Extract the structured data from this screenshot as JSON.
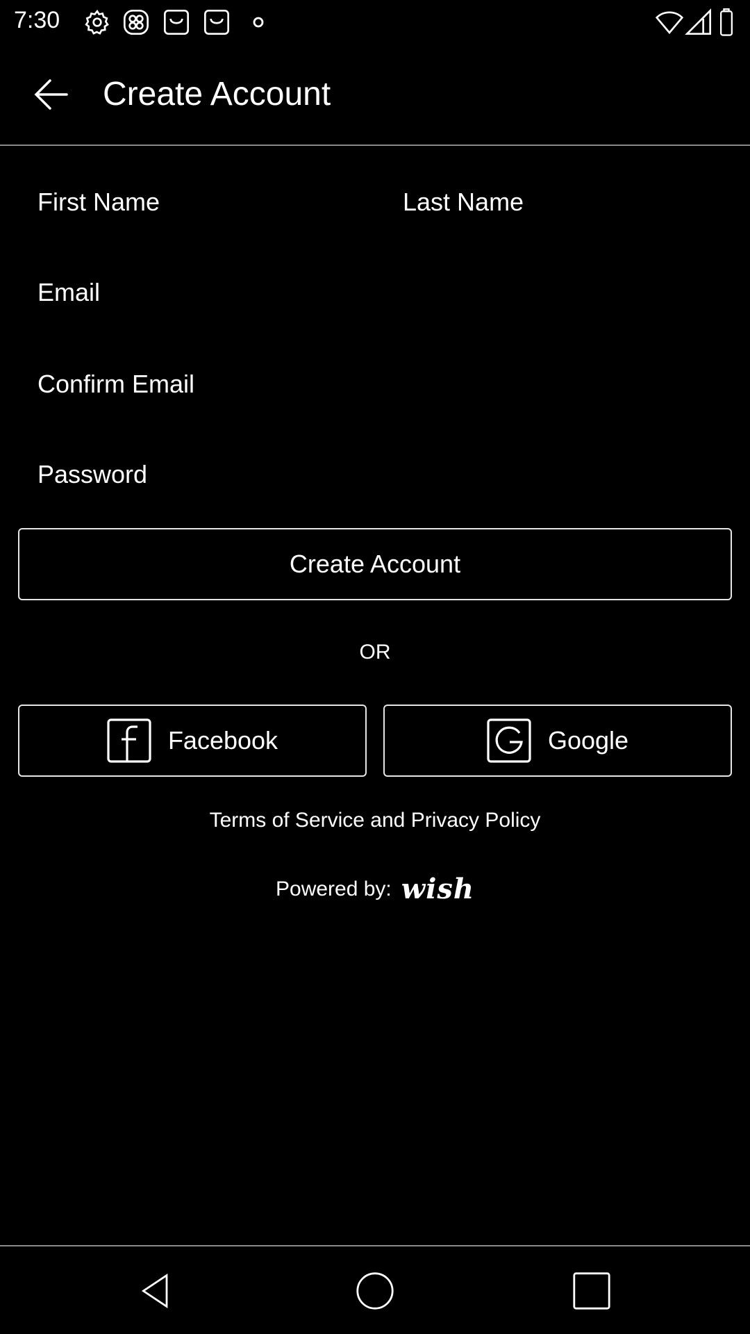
{
  "status_bar": {
    "time": "7:30",
    "icons": [
      "settings-icon",
      "app-icon",
      "wish-app-icon",
      "wish-app-icon",
      "dot-icon",
      "wifi-icon",
      "signal-icon",
      "battery-icon"
    ]
  },
  "app_bar": {
    "title": "Create Account",
    "back_icon": "arrow-left-icon"
  },
  "form": {
    "first_name_placeholder": "First Name",
    "last_name_placeholder": "Last Name",
    "email_placeholder": "Email",
    "confirm_email_placeholder": "Confirm Email",
    "password_placeholder": "Password",
    "submit_label": "Create Account"
  },
  "divider_text": "OR",
  "social": {
    "facebook_label": "Facebook",
    "facebook_icon": "facebook-icon",
    "google_label": "Google",
    "google_icon": "google-icon"
  },
  "terms_label": "Terms of Service and Privacy Policy",
  "powered_by": {
    "label": "Powered by:",
    "logo_text": "wish"
  },
  "nav_bar": {
    "icons": [
      "nav-back-icon",
      "nav-home-icon",
      "nav-recents-icon"
    ]
  },
  "colors": {
    "background": "#000000",
    "foreground": "#ffffff",
    "border": "#e6e6e6"
  }
}
